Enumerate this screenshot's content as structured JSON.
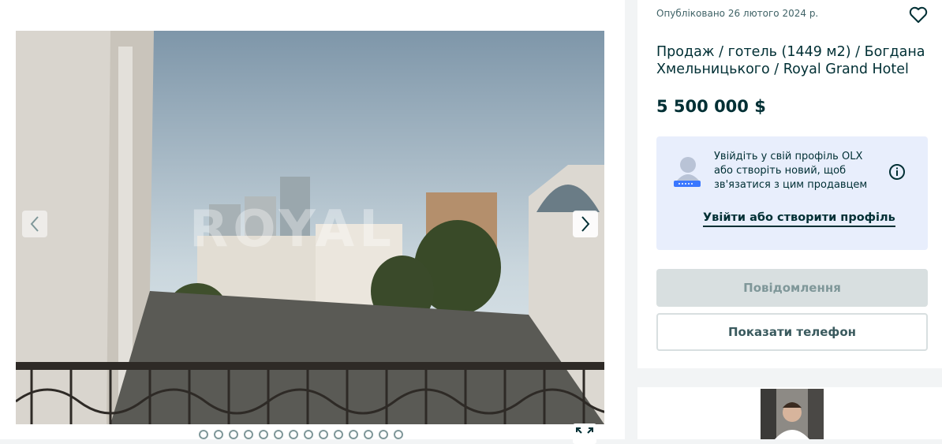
{
  "gallery": {
    "watermark": "ROYAL",
    "image_description_icon": "photo",
    "prev_icon": "chevron-left-icon",
    "next_icon": "chevron-right-icon",
    "expand_icon": "expand-icon",
    "dot_count": 14,
    "active_index": 0
  },
  "ad": {
    "posted": "Опубліковано 26 лютого 2024 р.",
    "title": "Продаж / готель (1449 м2) / Богдана Хмельницького / Royal Grand Hotel",
    "price": "5 500 000 $",
    "login_prompt": "Увійдіть у свій профіль OLX або створіть новий, щоб зв'язатися з цим продавцем",
    "login_link": "Увійти або створити профіль",
    "message_button": "Повідомлення",
    "phone_button": "Показати телефон"
  },
  "colors": {
    "text": "#002f34",
    "login_bg": "#e8eefc",
    "disabled_button": "#d8dfe0"
  }
}
